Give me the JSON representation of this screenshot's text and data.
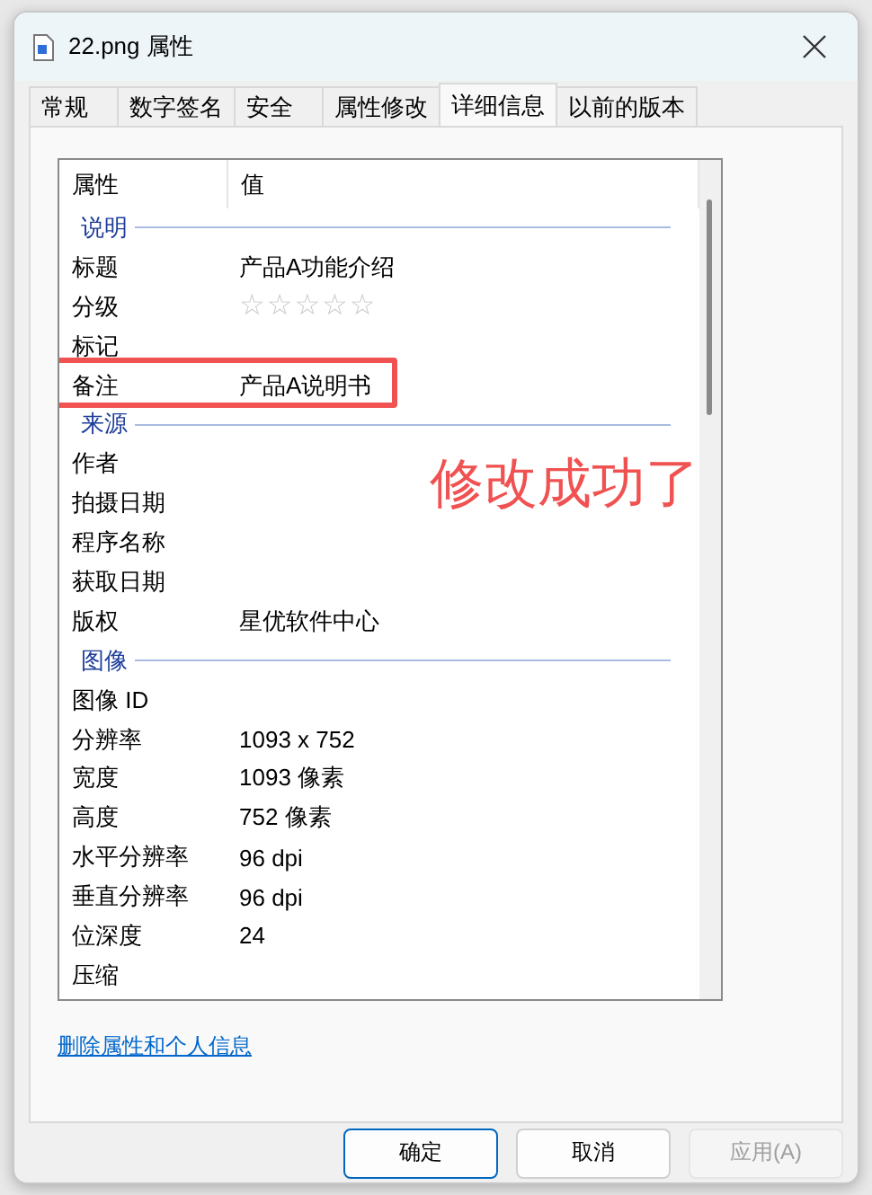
{
  "window": {
    "title": "22.png 属性"
  },
  "tabs": [
    {
      "label": "常规",
      "selected": false
    },
    {
      "label": "数字签名",
      "selected": false
    },
    {
      "label": "安全",
      "selected": false
    },
    {
      "label": "属性修改",
      "selected": false
    },
    {
      "label": "详细信息",
      "selected": true
    },
    {
      "label": "以前的版本",
      "selected": false
    }
  ],
  "table": {
    "columns": [
      "属性",
      "值"
    ],
    "rows": [
      {
        "kind": "section",
        "name": "说明"
      },
      {
        "kind": "text",
        "name": "标题",
        "value": "产品A功能介绍"
      },
      {
        "kind": "stars",
        "name": "分级",
        "stars": 0
      },
      {
        "kind": "text",
        "name": "标记"
      },
      {
        "kind": "text",
        "name": "备注",
        "value": "产品A说明书",
        "highlighted": true
      },
      {
        "kind": "section",
        "name": "来源"
      },
      {
        "kind": "text",
        "name": "作者"
      },
      {
        "kind": "text",
        "name": "拍摄日期"
      },
      {
        "kind": "text",
        "name": "程序名称"
      },
      {
        "kind": "text",
        "name": "获取日期"
      },
      {
        "kind": "text",
        "name": "版权",
        "value": "星优软件中心"
      },
      {
        "kind": "section",
        "name": "图像"
      },
      {
        "kind": "text",
        "name": "图像 ID"
      },
      {
        "kind": "text",
        "name": "分辨率",
        "value": "1093 x 752"
      },
      {
        "kind": "text",
        "name": "宽度",
        "value": "1093 像素"
      },
      {
        "kind": "text",
        "name": "高度",
        "value": "752 像素"
      },
      {
        "kind": "text",
        "name": "水平分辨率",
        "value": "96 dpi"
      },
      {
        "kind": "text",
        "name": "垂直分辨率",
        "value": "96 dpi"
      },
      {
        "kind": "text",
        "name": "位深度",
        "value": "24"
      },
      {
        "kind": "text",
        "name": "压缩"
      }
    ]
  },
  "annotation": {
    "text": "修改成功了"
  },
  "link": "删除属性和个人信息",
  "buttons": [
    {
      "label": "确定",
      "kind": "default",
      "disabled": false
    },
    {
      "label": "取消",
      "kind": "normal",
      "disabled": false
    },
    {
      "label": "应用(A)",
      "kind": "normal",
      "disabled": true
    }
  ]
}
